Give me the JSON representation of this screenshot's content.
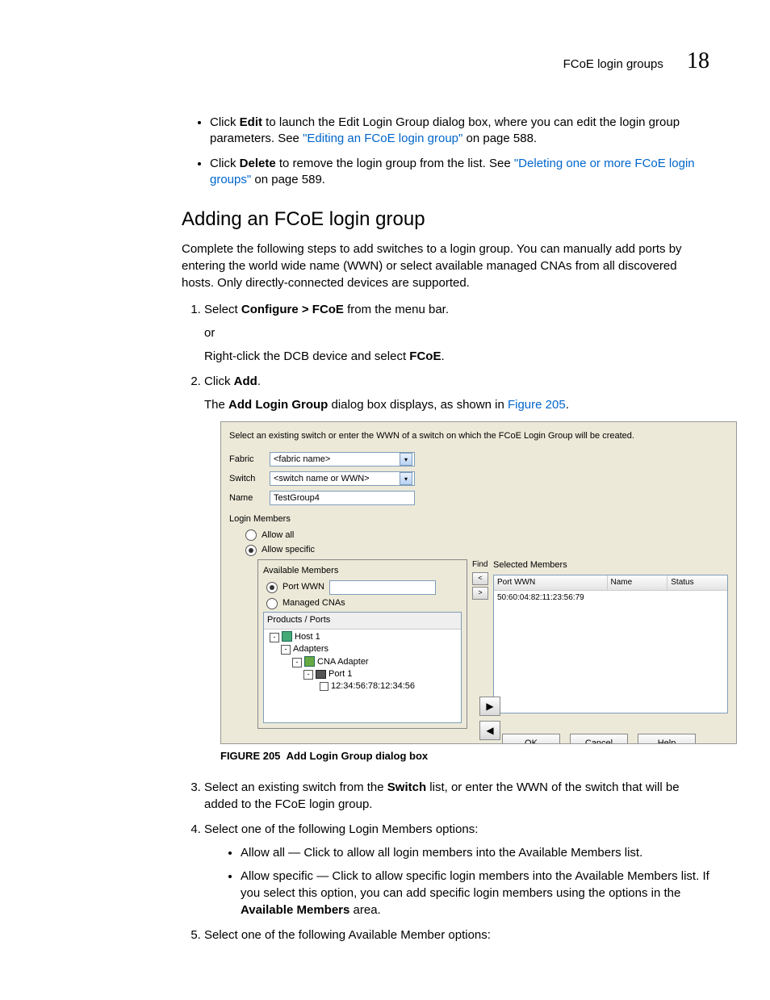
{
  "header": {
    "title": "FCoE login groups",
    "chapter": "18"
  },
  "intro_bullets": [
    {
      "pre": "Click ",
      "bold": "Edit",
      "mid": " to launch the Edit Login Group dialog box, where you can edit the login group parameters. See ",
      "link": "\"Editing an FCoE login group\"",
      "post": " on page 588."
    },
    {
      "pre": "Click ",
      "bold": "Delete",
      "mid": " to remove the login group from the list. See ",
      "link": "\"Deleting one or more FCoE login groups\"",
      "post": " on page 589."
    }
  ],
  "section_heading": "Adding an FCoE login group",
  "section_intro": "Complete the following steps to add switches to a login group. You can manually add ports by entering the world wide name (WWN) or select available managed CNAs from all discovered hosts. Only directly-connected devices are supported.",
  "steps": {
    "s1": {
      "pre": "Select ",
      "bold": "Configure > FCoE",
      "post": " from the menu bar."
    },
    "s1_or": "or",
    "s1_alt": {
      "pre": "Right-click the DCB device and select ",
      "bold": "FCoE",
      "post": "."
    },
    "s2": {
      "pre": "Click ",
      "bold": "Add",
      "post": "."
    },
    "s2_sub": {
      "pre": "The ",
      "bold": "Add Login Group",
      "mid": " dialog box displays, as shown in ",
      "link": "Figure 205",
      "post": "."
    },
    "s3": {
      "pre": "Select an existing switch from the ",
      "bold": "Switch",
      "post": " list, or enter the WWN of the switch that will be added to the FCoE login group."
    },
    "s4": "Select one of the following Login Members options:",
    "s4_items": [
      "Allow all — Click to allow all login members into the Available Members list.",
      {
        "text": "Allow specific — Click to allow specific login members into the Available Members list. If you select this option, you can add specific login members using the options in the ",
        "bold": "Available Members",
        "post": " area."
      }
    ],
    "s5": "Select one of the following Available Member options:"
  },
  "figure": {
    "label": "FIGURE 205",
    "caption": "Add Login Group dialog box"
  },
  "dialog": {
    "instruction": "Select an existing switch or enter the WWN of a switch on which the FCoE Login Group will be created.",
    "fabric_label": "Fabric",
    "fabric_value": "<fabric name>",
    "switch_label": "Switch",
    "switch_value": "<switch name or WWN>",
    "name_label": "Name",
    "name_value": "TestGroup4",
    "login_members": "Login Members",
    "allow_all": "Allow all",
    "allow_specific": "Allow specific",
    "avail_title": "Available Members",
    "port_wwn": "Port WWN",
    "managed_cnas": "Managed CNAs",
    "tree_header": "Products / Ports",
    "tree": {
      "host": "Host 1",
      "adapters": "Adapters",
      "cna": "CNA Adapter",
      "port": "Port 1",
      "wwn": "12:34:56:78:12:34:56"
    },
    "find": "Find",
    "sel_title": "Selected Members",
    "cols": {
      "wwn": "Port WWN",
      "name": "Name",
      "status": "Status"
    },
    "sel_row": "50:60:04:82:11:23:56:79",
    "btn_ok": "OK",
    "btn_cancel": "Cancel",
    "btn_help": "Help"
  }
}
